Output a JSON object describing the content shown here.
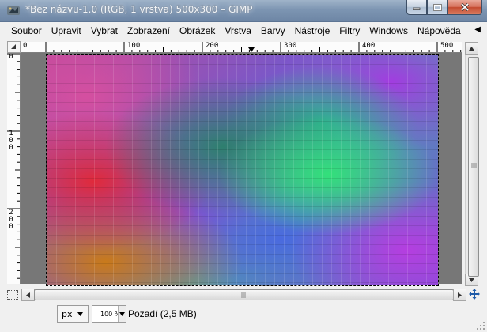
{
  "window": {
    "title": "*Bez názvu-1.0 (RGB, 1 vrstva) 500x300 – GIMP",
    "controls": {
      "minimize": "minimize-icon",
      "maximize": "maximize-icon",
      "close": "close-icon"
    }
  },
  "menubar": {
    "items": [
      {
        "label": "Soubor"
      },
      {
        "label": "Upravit"
      },
      {
        "label": "Vybrat"
      },
      {
        "label": "Zobrazení"
      },
      {
        "label": "Obrázek"
      },
      {
        "label": "Vrstva"
      },
      {
        "label": "Barvy"
      },
      {
        "label": "Nástroje"
      },
      {
        "label": "Filtry"
      },
      {
        "label": "Windows"
      },
      {
        "label": "Nápověda"
      }
    ],
    "overflow_icon": "menu-arrow-icon"
  },
  "rulers": {
    "horizontal": [
      "0",
      "100",
      "200",
      "300",
      "400",
      "500"
    ],
    "vertical": [
      "0",
      "100",
      "200"
    ]
  },
  "image": {
    "description_colors": [
      "#d54fa0",
      "#e02a3b",
      "#2e7f6e",
      "#33e07a",
      "#a23ce0",
      "#c97a1a"
    ]
  },
  "statusbar": {
    "unit": "px",
    "zoom": "100 %",
    "layer_info": "Pozadí (2,5 MB)"
  },
  "colors": {
    "titlebar": "#7d95b2",
    "menubar": "#f0f0f0",
    "canvas_bg": "#777777"
  }
}
